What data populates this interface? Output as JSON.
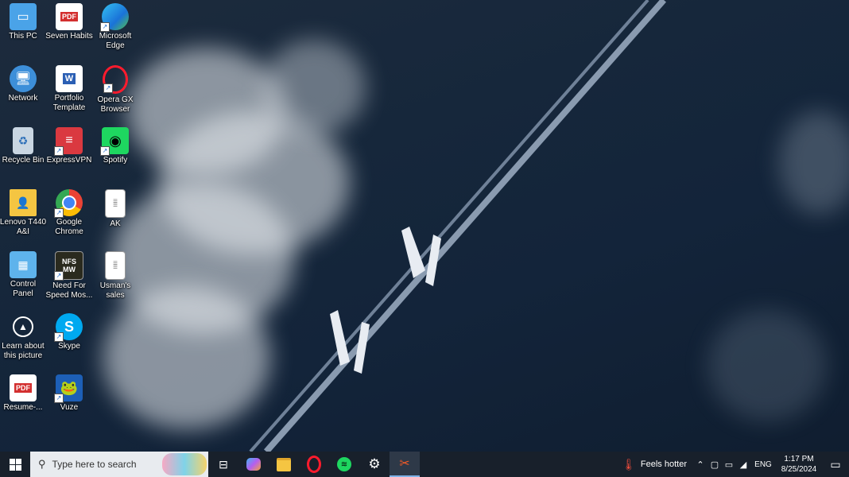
{
  "desktop": {
    "icons": [
      {
        "label": "This PC",
        "icon": "this-pc-icon"
      },
      {
        "label": "Seven Habits",
        "icon": "pdf-file-icon",
        "badge": "PDF"
      },
      {
        "label": "Microsoft Edge",
        "icon": "edge-icon"
      },
      {
        "label": "Network",
        "icon": "network-icon"
      },
      {
        "label": "Portfolio Template",
        "icon": "word-file-icon",
        "badge": "W"
      },
      {
        "label": "Opera GX Browser",
        "icon": "opera-gx-icon"
      },
      {
        "label": "Recycle Bin",
        "icon": "recycle-bin-icon"
      },
      {
        "label": "ExpressVPN",
        "icon": "expressvpn-icon"
      },
      {
        "label": "Spotify",
        "icon": "spotify-icon"
      },
      {
        "label": "Lenovo T440 A&I",
        "icon": "folder-icon"
      },
      {
        "label": "Google Chrome",
        "icon": "chrome-icon"
      },
      {
        "label": "AK",
        "icon": "text-file-icon"
      },
      {
        "label": "Control Panel",
        "icon": "control-panel-icon"
      },
      {
        "label": "Need For Speed Mos...",
        "icon": "nfs-game-icon",
        "badge": "NFS MW"
      },
      {
        "label": "Usman's sales",
        "icon": "text-file-icon"
      },
      {
        "label": "Learn about this picture",
        "icon": "learn-picture-icon"
      },
      {
        "label": "Skype",
        "icon": "skype-icon",
        "badge": "S"
      },
      {
        "label": "Resume-...",
        "icon": "pdf-file-icon",
        "badge": "PDF"
      },
      {
        "label": "Vuze",
        "icon": "vuze-icon"
      }
    ]
  },
  "taskbar": {
    "search_placeholder": "Type here to search",
    "weather_text": "Feels hotter",
    "language": "ENG",
    "time": "1:17 PM",
    "date": "8/25/2024",
    "pinned": [
      "task-view-icon",
      "copilot-icon",
      "file-explorer-icon",
      "opera-gx-icon",
      "spotify-icon",
      "settings-icon",
      "snipping-tool-icon"
    ]
  },
  "colors": {
    "taskbar_bg": "#18202b",
    "accent": "#7fb3e8"
  }
}
